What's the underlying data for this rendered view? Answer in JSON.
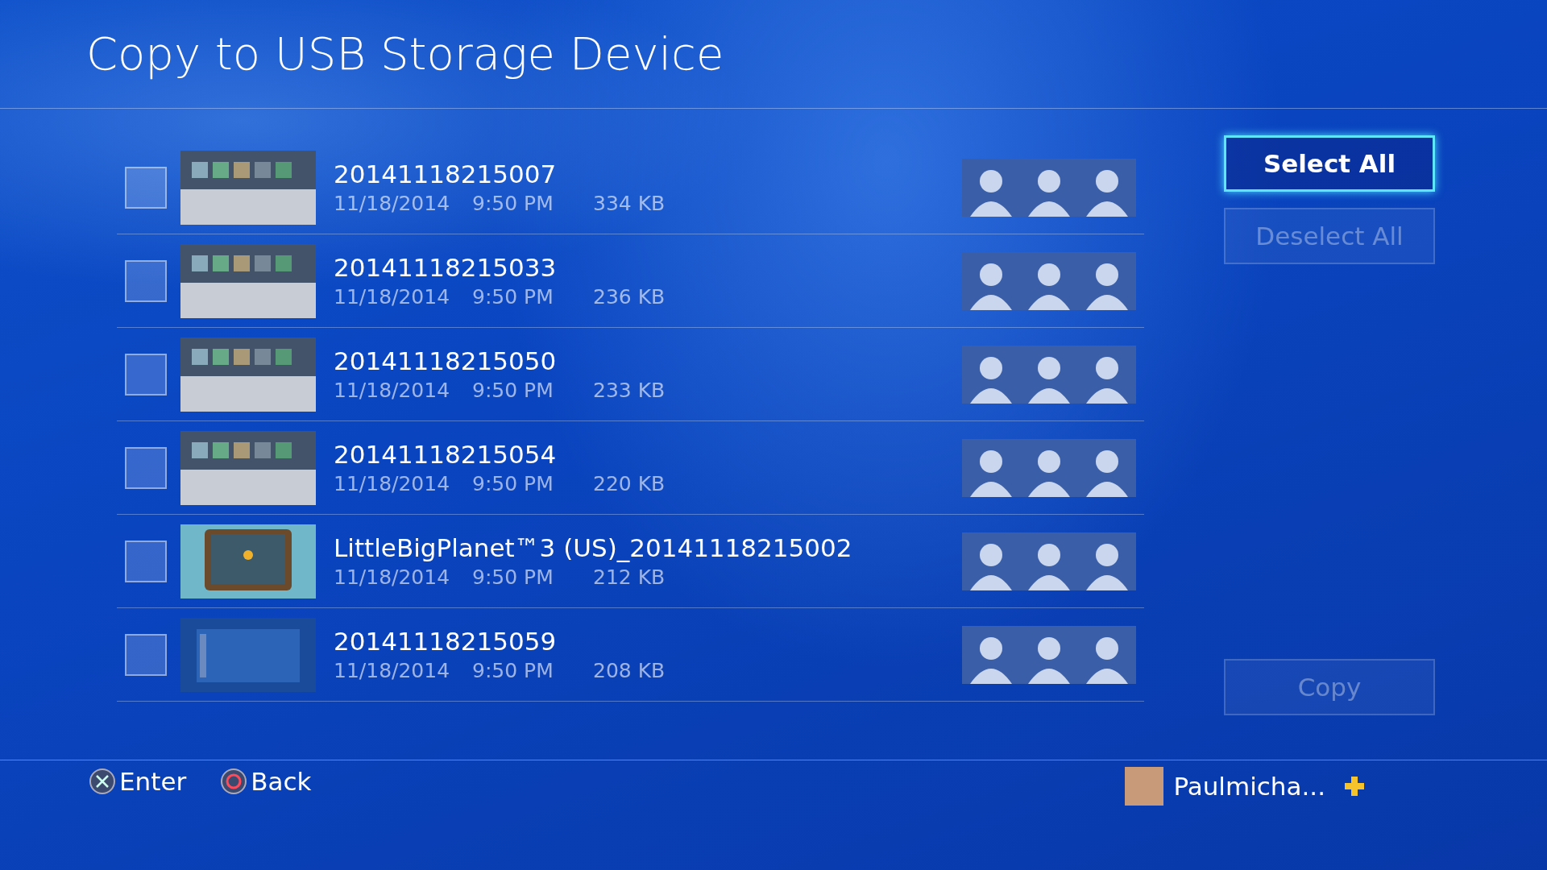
{
  "title": "Copy to USB Storage Device",
  "items": [
    {
      "name": "20141118215007",
      "date": "11/18/2014",
      "time": "9:50 PM",
      "size": "334 KB",
      "checked": false,
      "kind": "menu"
    },
    {
      "name": "20141118215033",
      "date": "11/18/2014",
      "time": "9:50 PM",
      "size": "236 KB",
      "checked": false,
      "kind": "menu"
    },
    {
      "name": "20141118215050",
      "date": "11/18/2014",
      "time": "9:50 PM",
      "size": "233 KB",
      "checked": false,
      "kind": "menu"
    },
    {
      "name": "20141118215054",
      "date": "11/18/2014",
      "time": "9:50 PM",
      "size": "220 KB",
      "checked": false,
      "kind": "menu"
    },
    {
      "name": "LittleBigPlanet™3 (US)_20141118215002",
      "date": "11/18/2014",
      "time": "9:50 PM",
      "size": "212 KB",
      "checked": false,
      "kind": "game"
    },
    {
      "name": "20141118215059",
      "date": "11/18/2014",
      "time": "9:50 PM",
      "size": "208 KB",
      "checked": false,
      "kind": "list"
    }
  ],
  "buttons": [
    {
      "label": "Select All",
      "selected": true,
      "disabled": false
    },
    {
      "label": "Deselect All",
      "selected": false,
      "disabled": true
    },
    {
      "label": "Copy",
      "selected": false,
      "disabled": true
    }
  ],
  "hints": [
    {
      "kind": "cross",
      "label": "Enter"
    },
    {
      "kind": "circle",
      "label": "Back"
    }
  ],
  "user": {
    "name": "Paulmicha...",
    "plus": true
  }
}
